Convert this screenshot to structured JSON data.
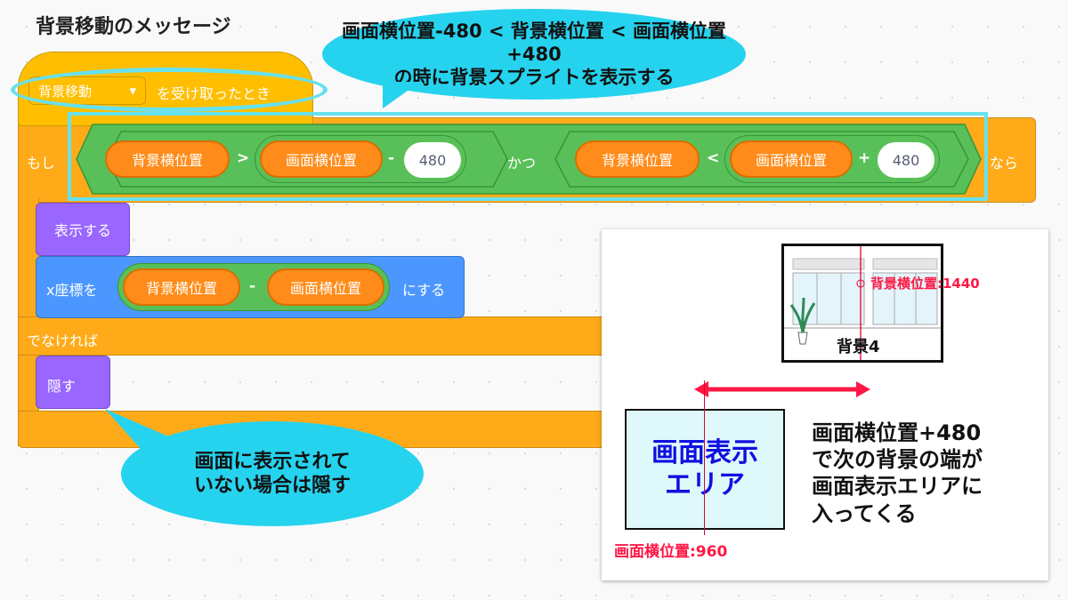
{
  "title": "背景移動のメッセージ",
  "callout_top": [
    "画面横位置-480 < 背景横位置 < 画面横位置+480",
    "の時に背景スプライトを表示する"
  ],
  "hat_block": {
    "dropdown": "背景移動",
    "text": "を受け取ったとき"
  },
  "if_block": {
    "if_label": "もし",
    "then_label": "なら",
    "and_label": "かつ",
    "left_compare": {
      "reporter_a": "背景横位置",
      "op": ">",
      "reporter_b": "画面横位置",
      "minus": "-",
      "value": "480"
    },
    "right_compare": {
      "reporter_a": "背景横位置",
      "op": "<",
      "reporter_b": "画面横位置",
      "plus": "+",
      "value": "480"
    }
  },
  "show_block": "表示する",
  "setx_block": {
    "label": "x座標を",
    "reporter_a": "背景横位置",
    "minus": "-",
    "reporter_b": "画面横位置",
    "suffix": "にする"
  },
  "else_label": "でなければ",
  "hide_block": "隠す",
  "callout_bottom": [
    "画面に表示されて",
    "いない場合は隠す"
  ],
  "diagram": {
    "bg_label": "背景4",
    "bg_pos_label": "背景横位置:1440",
    "screen_label": [
      "画面表示",
      "エリア"
    ],
    "screen_pos_label": "画面横位置:960",
    "explain": [
      "画面横位置+480",
      "で次の背景の端が",
      "画面表示エリアに",
      "入ってくる"
    ]
  },
  "colors": {
    "control": "#ffab19",
    "events": "#ffbf00",
    "operators": "#59c059",
    "variables": "#ff8c1a",
    "looks": "#9966ff",
    "motion": "#4c97ff",
    "callout": "#26d3ee",
    "highlight": "#ff1744",
    "screen_fill": "#dff9fb",
    "screen_text": "#1010e0"
  }
}
